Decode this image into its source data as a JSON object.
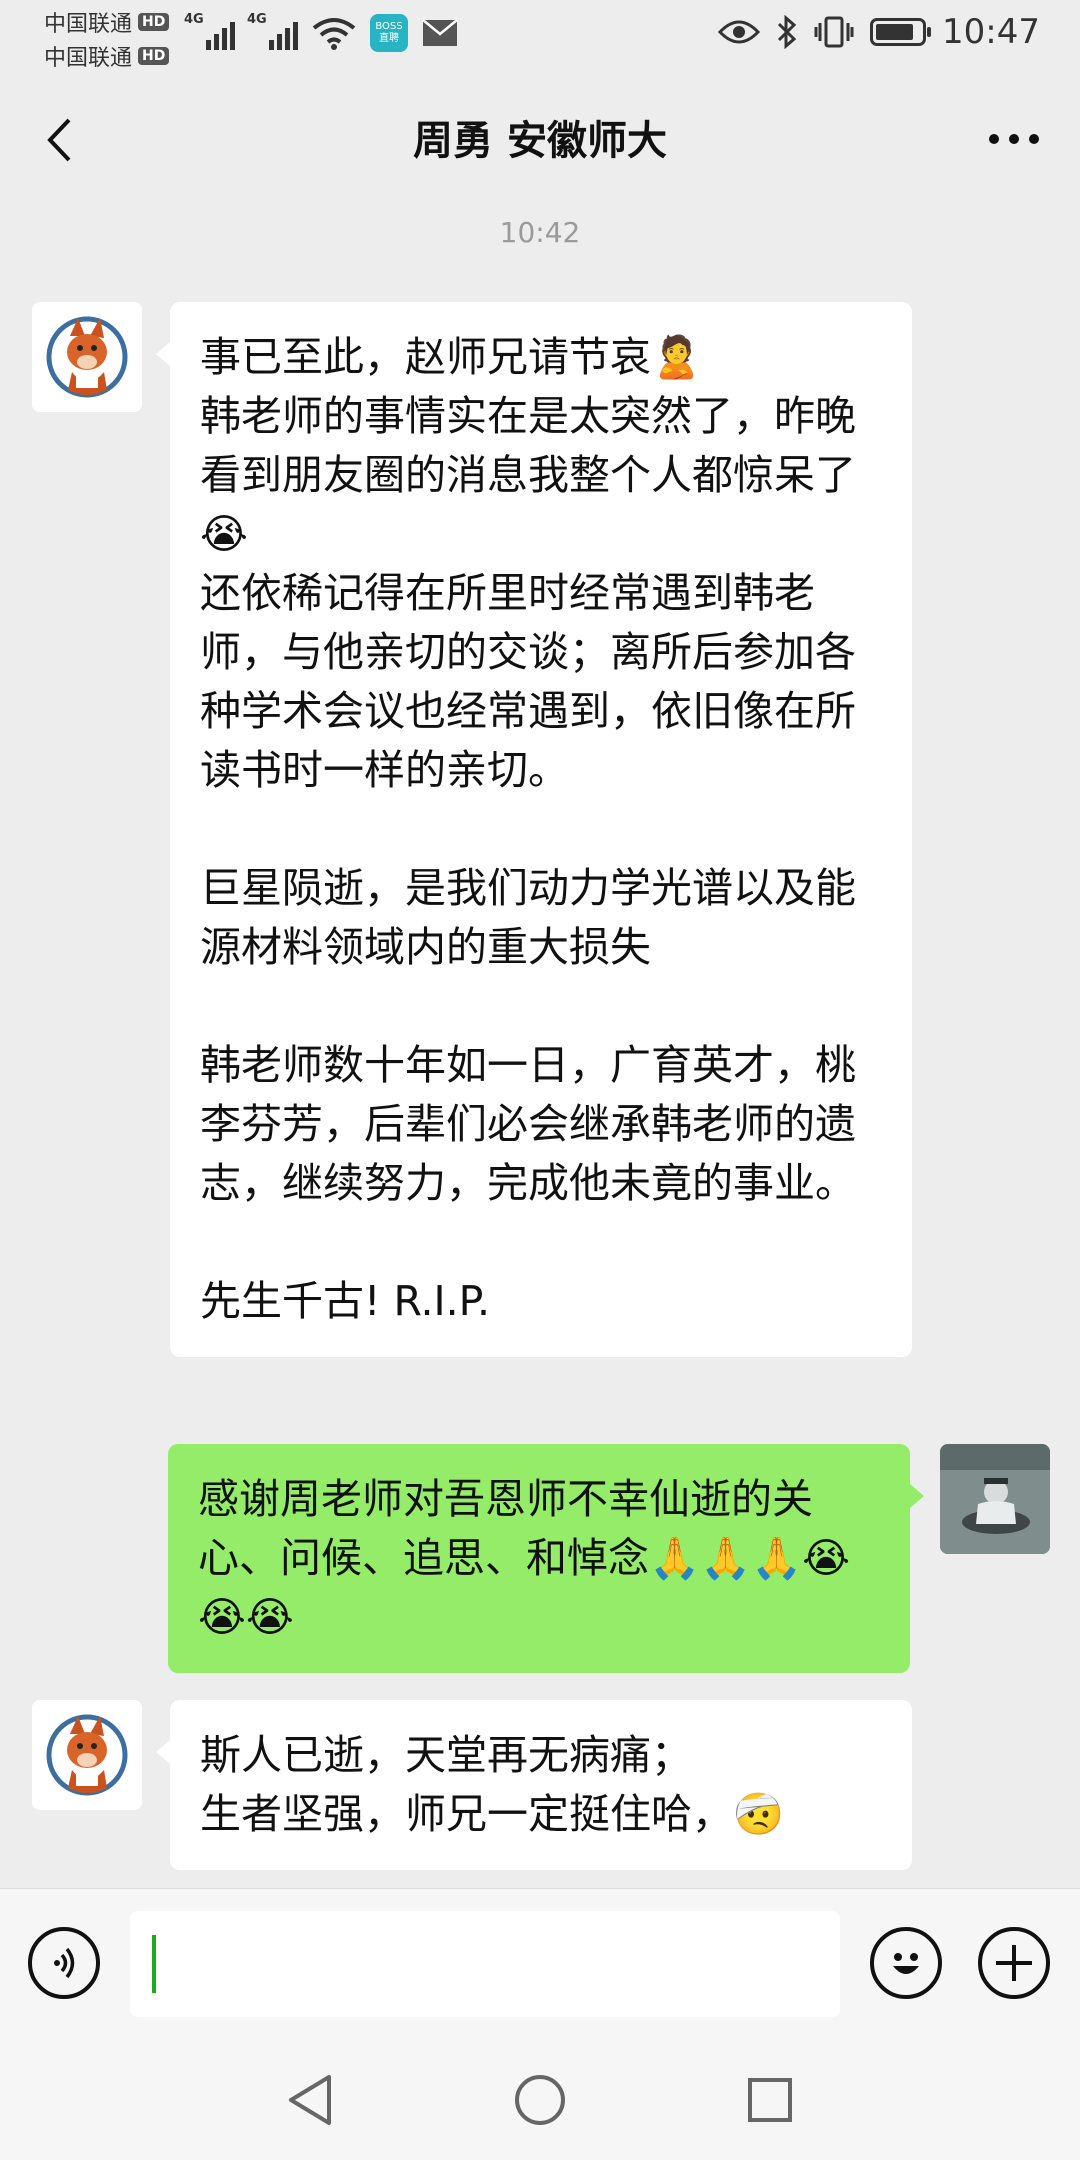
{
  "status_bar": {
    "carrier_1": "中国联通",
    "carrier_2": "中国联通",
    "hd_badge": "HD",
    "signal_1_label": "4G",
    "signal_2_label": "4G",
    "boss_badge_line1": "BOSS",
    "boss_badge_line2": "直聘",
    "time": "10:47",
    "battery_level": 0.85
  },
  "header": {
    "title": "周勇 安徽师大",
    "back_icon": "chevron-left-icon",
    "more_icon": "more-dots-icon"
  },
  "chat": {
    "timestamp": "10:42",
    "messages": [
      {
        "sender": "other",
        "text": "事已至此，赵师兄请节哀🙎\n韩老师的事情实在是太突然了，昨晚看到朋友圈的消息我整个人都惊呆了😭\n还依稀记得在所里时经常遇到韩老师，与他亲切的交谈；离所后参加各种学术会议也经常遇到，依旧像在所读书时一样的亲切。\n\n巨星陨逝，是我们动力学光谱以及能源材料领域内的重大损失\n\n韩老师数十年如一日，广育英才，桃李芬芳，后辈们必会继承韩老师的遗志，继续努力，完成他未竟的事业。\n\n先生千古! R.I.P."
      },
      {
        "sender": "self",
        "text": "感谢周老师对吾恩师不幸仙逝的关心、问候、追思、和悼念🙏🙏🙏😭😭😭"
      },
      {
        "sender": "other",
        "text": "斯人已逝，天堂再无病痛；\n生者坚强，师兄一定挺住哈，🤕"
      }
    ]
  },
  "input_bar": {
    "voice_icon": "voice-icon",
    "text_value": "",
    "emoji_icon": "emoji-icon",
    "plus_icon": "plus-icon"
  },
  "nav_bar": {
    "back_icon": "nav-back-icon",
    "home_icon": "nav-home-icon",
    "recents_icon": "nav-recents-icon"
  }
}
